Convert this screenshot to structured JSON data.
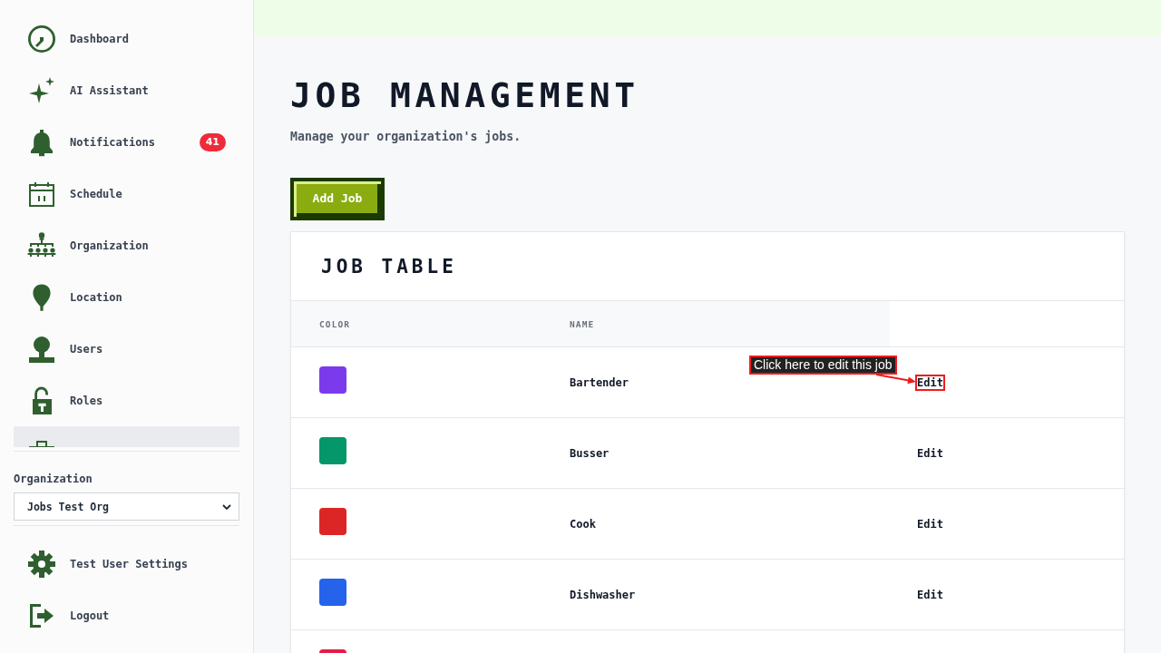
{
  "sidebar": {
    "nav_items": [
      {
        "label": "Dashboard",
        "selected": false
      },
      {
        "label": "AI Assistant",
        "selected": false
      },
      {
        "label": "Notifications",
        "badge": "41",
        "selected": false
      },
      {
        "label": "Schedule",
        "selected": false
      },
      {
        "label": "Organization",
        "selected": false
      },
      {
        "label": "Location",
        "selected": false
      },
      {
        "label": "Users",
        "selected": false
      },
      {
        "label": "Roles",
        "selected": false
      },
      {
        "selected": true
      }
    ],
    "organization": {
      "label": "Organization",
      "value": "Jobs Test Org"
    },
    "footer_items": [
      {
        "label": "Test User Settings"
      },
      {
        "label": "Logout"
      }
    ]
  },
  "page": {
    "title": "JOB MANAGEMENT",
    "subtitle": "Manage your organization's jobs.",
    "add_button": "Add Job"
  },
  "table": {
    "title": "JOB TABLE",
    "columns": [
      "COLOR",
      "NAME"
    ],
    "rows": [
      {
        "color": "#7c3aed",
        "name": "Bartender",
        "action": "Edit",
        "highlighted": true
      },
      {
        "color": "#059669",
        "name": "Busser",
        "action": "Edit",
        "highlighted": false
      },
      {
        "color": "#dc2626",
        "name": "Cook",
        "action": "Edit",
        "highlighted": false
      },
      {
        "color": "#2563eb",
        "name": "Dishwasher",
        "action": "Edit",
        "highlighted": false
      },
      {
        "color": "#e11d48"
      }
    ]
  },
  "callout": {
    "text": "Click here to edit this job"
  }
}
